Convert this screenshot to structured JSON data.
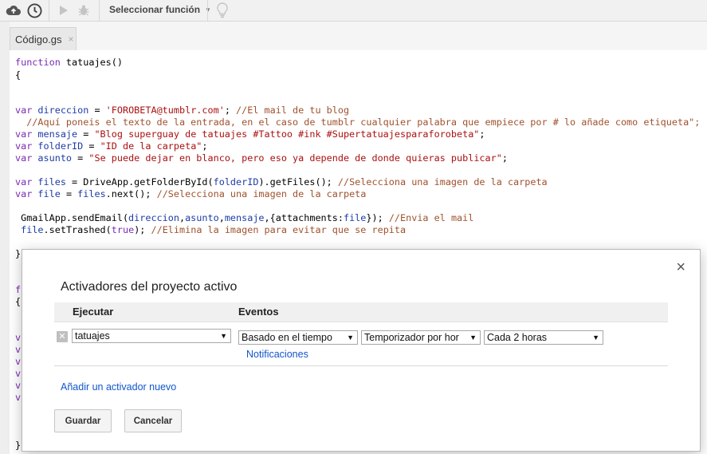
{
  "toolbar": {
    "function_select_label": "Seleccionar función"
  },
  "file_tab": {
    "name": "Código.gs",
    "close": "×"
  },
  "code_lines": [
    "function tatuajes()",
    "{",
    "var direccion = 'FOROBETA@tumblr.com'; //El mail de tu blog",
    "  //Aquí poneis el texto de la entrada, en el caso de tumblr cualquier palabra que empiece por # lo añade como etiqueta\";",
    "var mensaje = \"Blog superguay de tatuajes #Tattoo #ink #Supertatuajesparaforobeta\";",
    "var folderID = \"ID de la carpeta\";",
    "var asunto = \"Se puede dejar en blanco, pero eso ya depende de donde quieras publicar\";",
    "var files = DriveApp.getFolderById(folderID).getFiles(); //Selecciona una imagen de la carpeta",
    "var file = files.next(); //Selecciona una imagen de la carpeta",
    " GmailApp.sendEmail(direccion,asunto,mensaje,{attachments:file}); //Envia el mail",
    " file.setTrashed(true); //Elimina la imagen para evitar que se repita",
    "}",
    "f",
    "{",
    "v",
    "v",
    "v",
    "v",
    "v",
    "v",
    "}"
  ],
  "dialog": {
    "title": "Activadores del proyecto activo",
    "close": "×",
    "header_execute": "Ejecutar",
    "header_events": "Eventos",
    "trigger": {
      "function": "tatuajes",
      "event_source": "Basado en el tiempo",
      "timer_type": "Temporizador por hor",
      "interval": "Cada 2 horas",
      "notifications_link": "Notificaciones",
      "delete": "✕"
    },
    "add_trigger_link": "Añadir un activador nuevo",
    "save_button": "Guardar",
    "cancel_button": "Cancelar"
  },
  "colors": {
    "link": "#1155cc",
    "keyword": "#7a2bb5",
    "string": "#a11",
    "variable": "#1d3da6",
    "comment": "#a0522d"
  }
}
